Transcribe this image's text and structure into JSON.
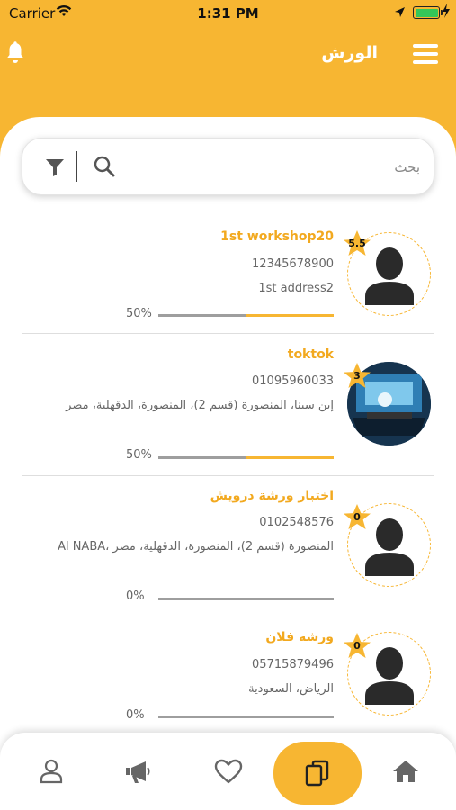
{
  "status_bar": {
    "carrier": "Carrier",
    "time": "1:31 PM",
    "battery_color": "#35c759"
  },
  "header": {
    "title": "الورش",
    "background": "#f7b632",
    "left_icon": "bell-icon",
    "right_icon": "hamburger-menu-icon"
  },
  "search": {
    "placeholder": "بحث",
    "value": "",
    "icons": [
      "search-icon",
      "filter-icon"
    ]
  },
  "workshops": [
    {
      "name": "1st workshop20",
      "phone": "12345678900",
      "address": "1st address2",
      "rating": "5.5",
      "progress_label": "50%",
      "progress": 0.5,
      "avatar": "person-placeholder-icon"
    },
    {
      "name": "toktok",
      "phone": "01095960033",
      "address": "إبن سينا، المنصورة (قسم 2)، المنصورة، الدقهلية، مصر",
      "rating": "3",
      "progress_label": "50%",
      "progress": 0.5,
      "avatar": "photo"
    },
    {
      "name": "اختبار ورشة درويش",
      "phone": "0102548576",
      "address": "Al NABA، المنصورة (قسم 2)، المنصورة، الدقهلية، مصر",
      "rating": "0",
      "progress_label": "0%",
      "progress": 0,
      "avatar": "person-placeholder-icon"
    },
    {
      "name": "ورشة فلان",
      "phone": "05715879496",
      "address": "الرياض، السعودية",
      "rating": "0",
      "progress_label": "0%",
      "progress": 0,
      "avatar": "person-placeholder-icon"
    }
  ],
  "tab_bar": {
    "tabs": [
      {
        "icon": "profile-icon",
        "active": false
      },
      {
        "icon": "megaphone-icon",
        "active": false
      },
      {
        "icon": "heart-icon",
        "active": false
      },
      {
        "icon": "copy-documents-icon",
        "active": true
      },
      {
        "icon": "home-icon",
        "active": false
      }
    ],
    "active_color": "#f7b632"
  }
}
